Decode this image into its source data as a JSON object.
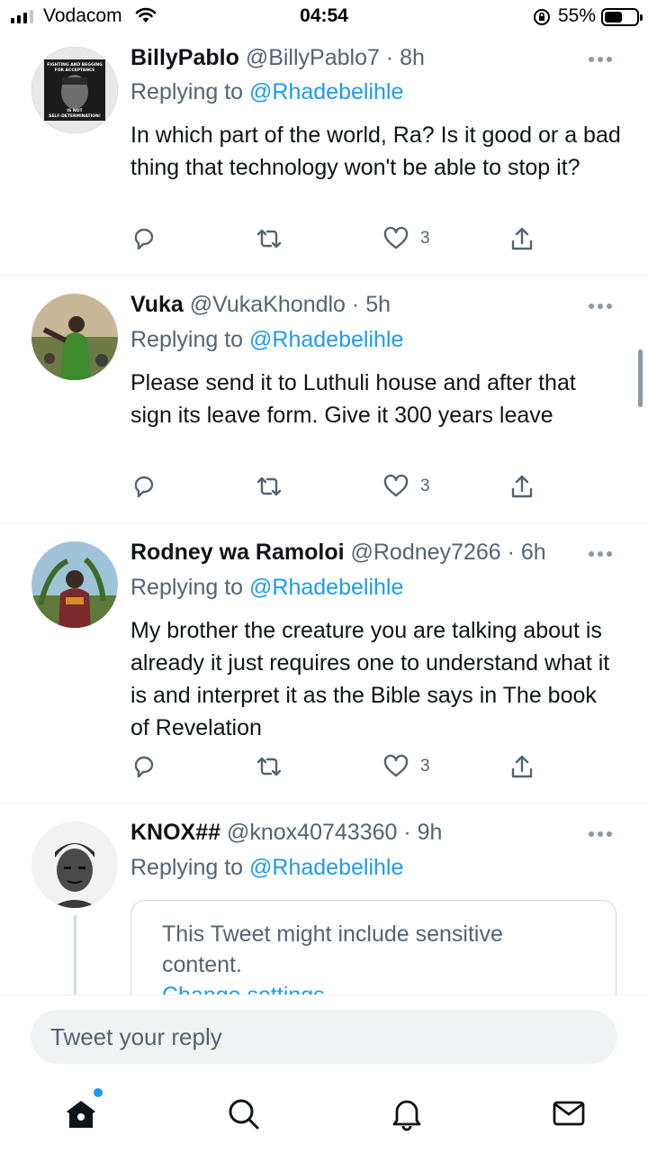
{
  "status_bar": {
    "carrier": "Vodacom",
    "time": "04:54",
    "battery": "55%",
    "battery_level": 0.55,
    "icons": [
      "signal-icon",
      "wifi-icon",
      "orientation-lock-icon",
      "battery-icon"
    ]
  },
  "tweets": [
    {
      "name": "BillyPablo",
      "handle": "@BillyPablo7",
      "time": "8h",
      "replying_label": "Replying to",
      "replying_to": "@Rhadebelihle",
      "text": "In which part of the world, Ra? Is it good or a bad thing that technology won't be able to stop it?",
      "likes": "3",
      "avatar_text": [
        "FIGHTING AND BEGGING",
        "FOR ACCEPTANCE",
        "IS NOT",
        "SELF-DETERMINATION!"
      ]
    },
    {
      "name": "Vuka",
      "handle": "@VukaKhondlo",
      "time": "5h",
      "replying_label": "Replying to",
      "replying_to": "@Rhadebelihle",
      "text": "Please send it to Luthuli house and after that sign its leave form. Give it 300 years leave",
      "likes": "3"
    },
    {
      "name": "Rodney wa Ramoloi",
      "handle": "@Rodney7266",
      "time": "6h",
      "replying_label": "Replying to",
      "replying_to": "@Rhadebelihle",
      "text": "My brother the creature you are talking about is already it just requires one to understand what it is and interpret it as the Bible says in The book of Revelation",
      "likes": "3"
    },
    {
      "name": "KNOX##",
      "handle": "@knox40743360",
      "time": "9h",
      "replying_label": "Replying to",
      "replying_to": "@Rhadebelihle",
      "sensitive_notice": "This Tweet might include sensitive content.",
      "sensitive_link": "Change settings"
    }
  ],
  "composer": {
    "placeholder": "Tweet your reply"
  },
  "colors": {
    "accent": "#1d9bf0",
    "secondary_text": "#536471",
    "divider": "#eff3f4"
  },
  "nav_icons": [
    "home-icon",
    "search-icon",
    "notifications-icon",
    "messages-icon"
  ]
}
